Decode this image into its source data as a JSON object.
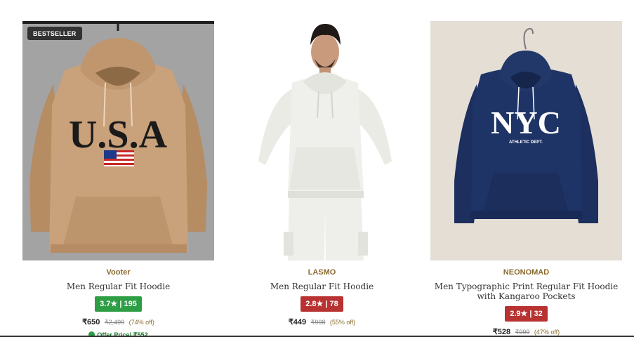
{
  "products": [
    {
      "badge": "BESTSELLER",
      "brand": "Vooter",
      "title": "Men Regular Fit Hoodie",
      "rating": "3.7★ | 195",
      "price": "₹650",
      "mrp": "₹2,499",
      "discount": "(74% off)",
      "offer": "Offer Price! ₹552",
      "hoodie_print": "U.S.A",
      "image_subject": "tan-usa-hoodie",
      "colors": {
        "garment": "#c9a17a",
        "background": "#9e9e9e",
        "print": "#1a1a1a"
      }
    },
    {
      "brand": "LASMO",
      "title": "Men Regular Fit Hoodie",
      "rating": "2.8★ | 78",
      "price": "₹449",
      "mrp": "₹998",
      "discount": "(55% off)",
      "image_subject": "white-hoodie-model",
      "colors": {
        "garment": "#eeeeea",
        "background": "#ffffff"
      }
    },
    {
      "brand": "NEONOMAD",
      "title": "Men Typographic Print Regular Fit Hoodie with Kangaroo Pockets",
      "rating": "2.9★ | 32",
      "price": "₹528",
      "mrp": "₹999",
      "discount": "(47% off)",
      "hoodie_print": "NYC",
      "hoodie_subprint": "ATHLETIC DEPT.",
      "image_subject": "navy-nyc-hoodie",
      "colors": {
        "garment": "#1f3466",
        "background": "#e4ded5",
        "print": "#ffffff"
      }
    }
  ],
  "colors": {
    "brand_text": "#8a6a2e",
    "rating_good": "#2e9e45",
    "rating_bad": "#b83232",
    "offer_green": "#1b7a2a"
  }
}
